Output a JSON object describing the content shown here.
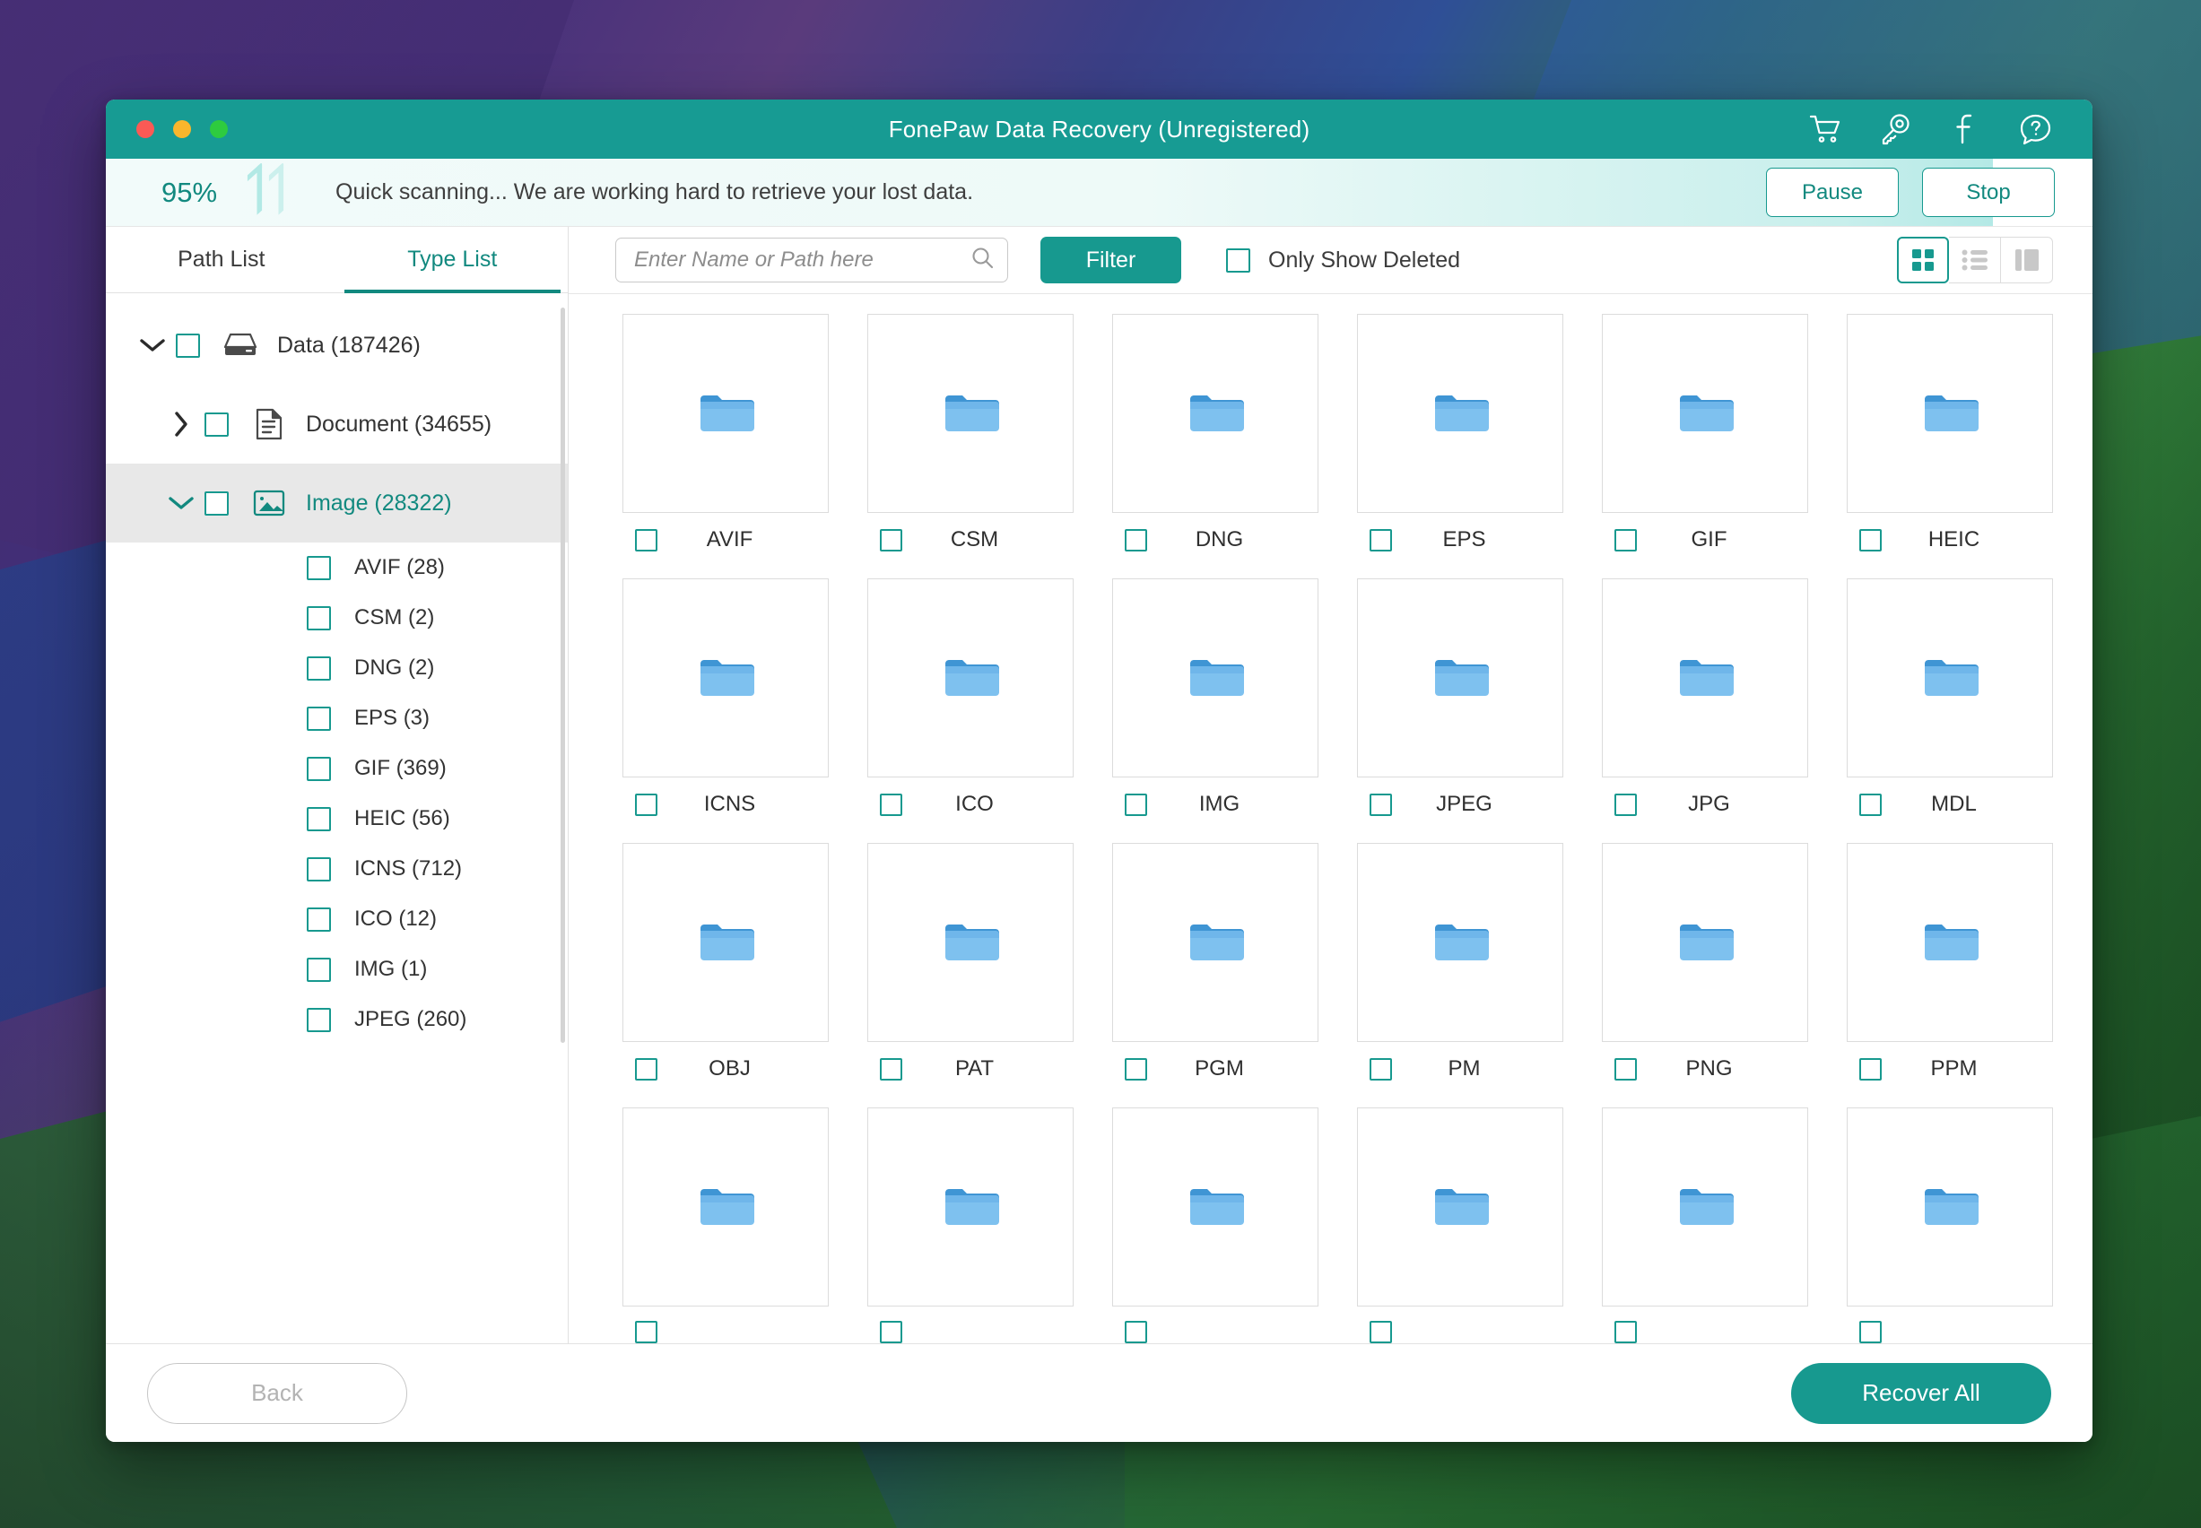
{
  "window": {
    "title": "FonePaw Data Recovery (Unregistered)",
    "traffic_lights": [
      "close",
      "minimize",
      "zoom"
    ],
    "toolbar_icons": [
      "cart-icon",
      "key-icon",
      "facebook-icon",
      "help-icon"
    ]
  },
  "progress": {
    "percent_label": "95%",
    "percent_value": 95,
    "message": "Quick scanning... We are working hard to retrieve your lost data.",
    "pause_label": "Pause",
    "stop_label": "Stop"
  },
  "sidebar": {
    "tabs": [
      {
        "label": "Path List",
        "active": false
      },
      {
        "label": "Type List",
        "active": true
      }
    ],
    "tree": [
      {
        "label": "Data (187426)",
        "icon": "drive-icon",
        "level": 0,
        "expanded": true,
        "selected": false
      },
      {
        "label": "Document (34655)",
        "icon": "document-icon",
        "level": 1,
        "expanded": false,
        "selected": false
      },
      {
        "label": "Image (28322)",
        "icon": "image-icon",
        "level": 1,
        "expanded": true,
        "selected": true
      }
    ],
    "leaves": [
      {
        "label": "AVIF (28)"
      },
      {
        "label": "CSM (2)"
      },
      {
        "label": "DNG (2)"
      },
      {
        "label": "EPS (3)"
      },
      {
        "label": "GIF (369)"
      },
      {
        "label": "HEIC (56)"
      },
      {
        "label": "ICNS (712)"
      },
      {
        "label": "ICO (12)"
      },
      {
        "label": "IMG (1)"
      },
      {
        "label": "JPEG (260)"
      }
    ]
  },
  "toolbar": {
    "search_placeholder": "Enter Name or Path here",
    "search_value": "",
    "search_icon": "search-icon",
    "filter_label": "Filter",
    "only_show_deleted_label": "Only Show Deleted",
    "only_show_deleted_checked": false,
    "views": [
      {
        "name": "grid-view",
        "active": true
      },
      {
        "name": "list-view",
        "active": false
      },
      {
        "name": "column-view",
        "active": false
      }
    ]
  },
  "grid": {
    "items": [
      {
        "name": "AVIF",
        "icon": "folder-icon",
        "checked": false
      },
      {
        "name": "CSM",
        "icon": "folder-icon",
        "checked": false
      },
      {
        "name": "DNG",
        "icon": "folder-icon",
        "checked": false
      },
      {
        "name": "EPS",
        "icon": "folder-icon",
        "checked": false
      },
      {
        "name": "GIF",
        "icon": "folder-icon",
        "checked": false
      },
      {
        "name": "HEIC",
        "icon": "folder-icon",
        "checked": false
      },
      {
        "name": "ICNS",
        "icon": "folder-icon",
        "checked": false
      },
      {
        "name": "ICO",
        "icon": "folder-icon",
        "checked": false
      },
      {
        "name": "IMG",
        "icon": "folder-icon",
        "checked": false
      },
      {
        "name": "JPEG",
        "icon": "folder-icon",
        "checked": false
      },
      {
        "name": "JPG",
        "icon": "folder-icon",
        "checked": false
      },
      {
        "name": "MDL",
        "icon": "folder-icon",
        "checked": false
      },
      {
        "name": "OBJ",
        "icon": "folder-icon",
        "checked": false
      },
      {
        "name": "PAT",
        "icon": "folder-icon",
        "checked": false
      },
      {
        "name": "PGM",
        "icon": "folder-icon",
        "checked": false
      },
      {
        "name": "PM",
        "icon": "folder-icon",
        "checked": false
      },
      {
        "name": "PNG",
        "icon": "folder-icon",
        "checked": false
      },
      {
        "name": "PPM",
        "icon": "folder-icon",
        "checked": false
      },
      {
        "name": "",
        "icon": "folder-icon",
        "checked": false
      },
      {
        "name": "",
        "icon": "folder-icon",
        "checked": false
      },
      {
        "name": "",
        "icon": "folder-icon",
        "checked": false
      },
      {
        "name": "",
        "icon": "folder-icon",
        "checked": false
      },
      {
        "name": "",
        "icon": "folder-icon",
        "checked": false
      },
      {
        "name": "",
        "icon": "folder-icon",
        "checked": false
      }
    ]
  },
  "footer": {
    "back_label": "Back",
    "recover_label": "Recover All"
  },
  "colors": {
    "accent": "#17998f",
    "accent_dark": "#12897f",
    "folder_blue": "#7ec1ef",
    "folder_tab": "#3f95d4"
  }
}
